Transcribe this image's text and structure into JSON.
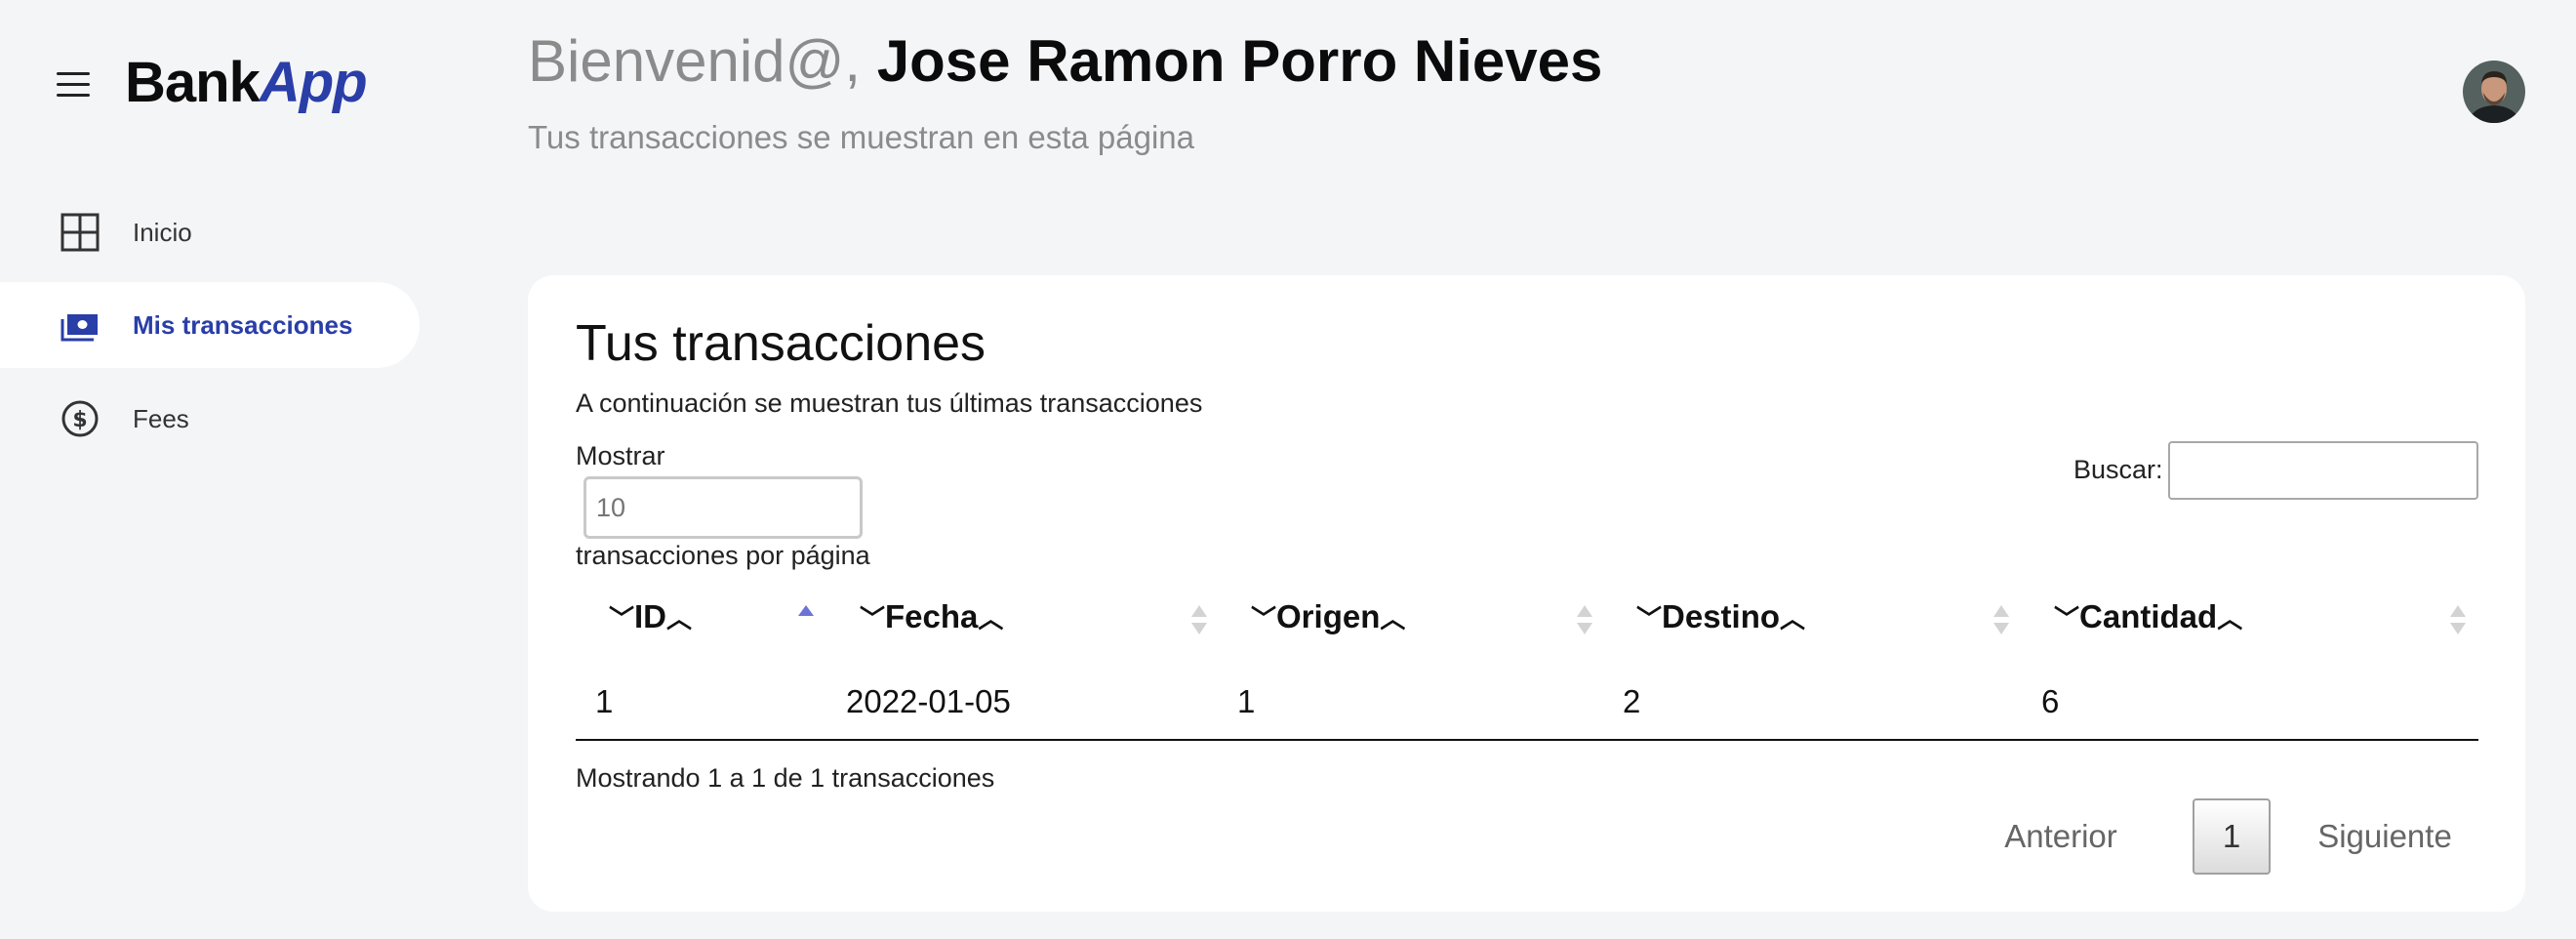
{
  "app": {
    "logo_part1": "Bank",
    "logo_part2": "App"
  },
  "sidebar": {
    "items": [
      {
        "label": "Inicio",
        "icon": "grid-icon",
        "active": false
      },
      {
        "label": "Mis transacciones",
        "icon": "cash-icon",
        "active": true
      },
      {
        "label": "Fees",
        "icon": "dollar-circle-icon",
        "active": false
      }
    ]
  },
  "header": {
    "greeting_prefix": "Bienvenid@,",
    "user_name": "Jose Ramon Porro Nieves",
    "subtitle": "Tus transacciones se muestran en esta página"
  },
  "card": {
    "title": "Tus transacciones",
    "subtitle": "A continuación se muestran tus últimas transacciones",
    "show_label": "Mostrar",
    "show_placeholder": "10",
    "show_suffix": "transacciones por página",
    "search_label": "Buscar:",
    "search_value": ""
  },
  "table": {
    "columns": [
      "ID",
      "Fecha",
      "Origen",
      "Destino",
      "Cantidad"
    ],
    "rows": [
      [
        "1",
        "2022-01-05",
        "1",
        "2",
        "6"
      ]
    ],
    "sorted_column": "ID",
    "sort_direction": "asc",
    "accent_color": "#6b73d6"
  },
  "footer": {
    "info": "Mostrando 1 a 1 de 1 transacciones",
    "prev_label": "Anterior",
    "current_page": "1",
    "next_label": "Siguiente"
  },
  "colors": {
    "brand": "#2a3ea8",
    "background": "#f4f5f7"
  }
}
